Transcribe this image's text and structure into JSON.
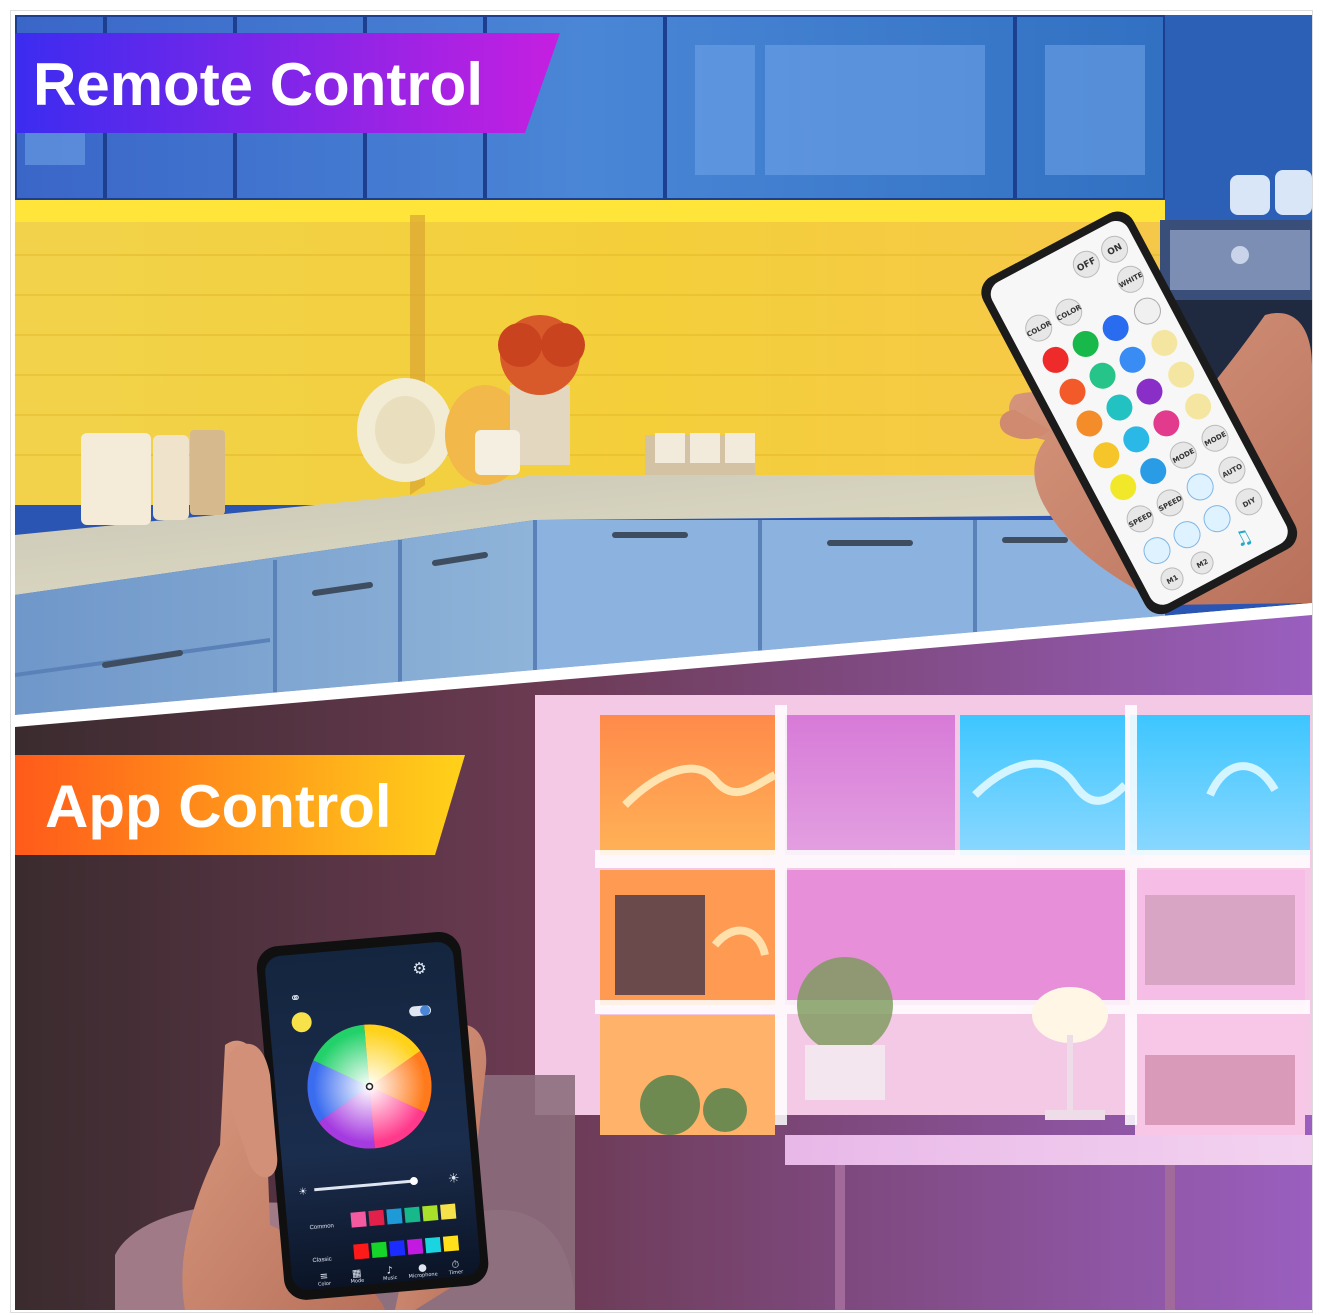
{
  "banners": {
    "top": "Remote Control",
    "bottom": "App Control"
  },
  "remote": {
    "row1": [
      "OFF",
      "ON"
    ],
    "row2": [
      "COLOR",
      "COLOR",
      "WHITE"
    ],
    "mode_labels": [
      "MODE",
      "MODE"
    ],
    "speed_labels": [
      "SPEED",
      "SPEED"
    ],
    "auto_label": "AUTO",
    "diy_label": "DIY",
    "m_labels": [
      "M1",
      "M2"
    ]
  },
  "phone": {
    "sections": {
      "custom": "Common",
      "classic": "Classic"
    },
    "nav": [
      "Color",
      "Mode",
      "Music",
      "Microphone",
      "Timer"
    ]
  },
  "colors": {
    "top_banner": [
      "#3b2cf0",
      "#c61fe0"
    ],
    "bottom_banner": [
      "#ff5a1a",
      "#ffd21a"
    ]
  }
}
